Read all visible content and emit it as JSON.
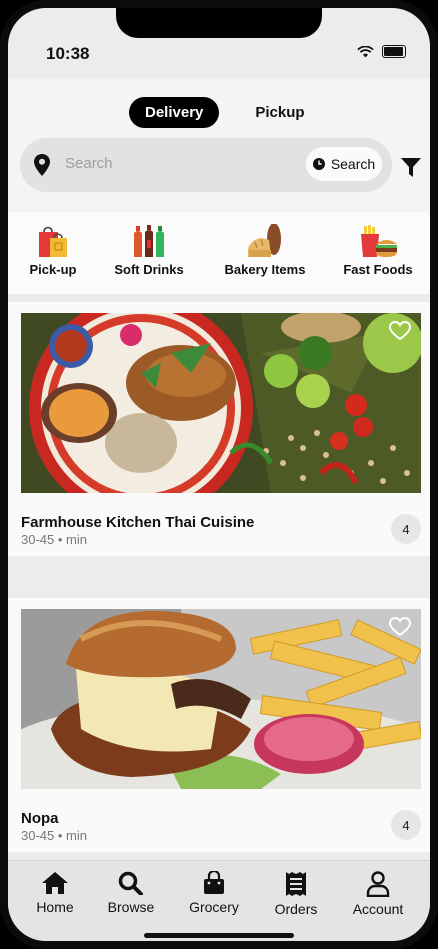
{
  "status_bar": {
    "time": "10:38"
  },
  "mode_toggle": {
    "delivery_label": "Delivery",
    "pickup_label": "Pickup",
    "selected": "Delivery"
  },
  "search": {
    "placeholder": "Search",
    "button_label": "Search"
  },
  "categories": [
    {
      "label": "Pick-up",
      "icon": "shopping-bags-icon"
    },
    {
      "label": "Soft Drinks",
      "icon": "soda-bottles-icon"
    },
    {
      "label": "Bakery Items",
      "icon": "bread-icon"
    },
    {
      "label": "Fast Foods",
      "icon": "burger-fries-icon"
    }
  ],
  "restaurants": [
    {
      "name": "Farmhouse Kitchen Thai Cuisine",
      "time": "30-45",
      "unit": "min",
      "rating": "4",
      "favorited": false
    },
    {
      "name": "Nopa",
      "time": "30-45",
      "unit": "min",
      "rating": "4",
      "favorited": false
    }
  ],
  "bottom_nav": [
    {
      "label": "Home",
      "icon": "home-icon"
    },
    {
      "label": "Browse",
      "icon": "magnifier-icon"
    },
    {
      "label": "Grocery",
      "icon": "shopping-bag-icon"
    },
    {
      "label": "Orders",
      "icon": "receipt-icon"
    },
    {
      "label": "Account",
      "icon": "person-icon"
    }
  ],
  "colors": {
    "accent": "#000000",
    "background": "#ececec",
    "surface": "#fafafa"
  }
}
